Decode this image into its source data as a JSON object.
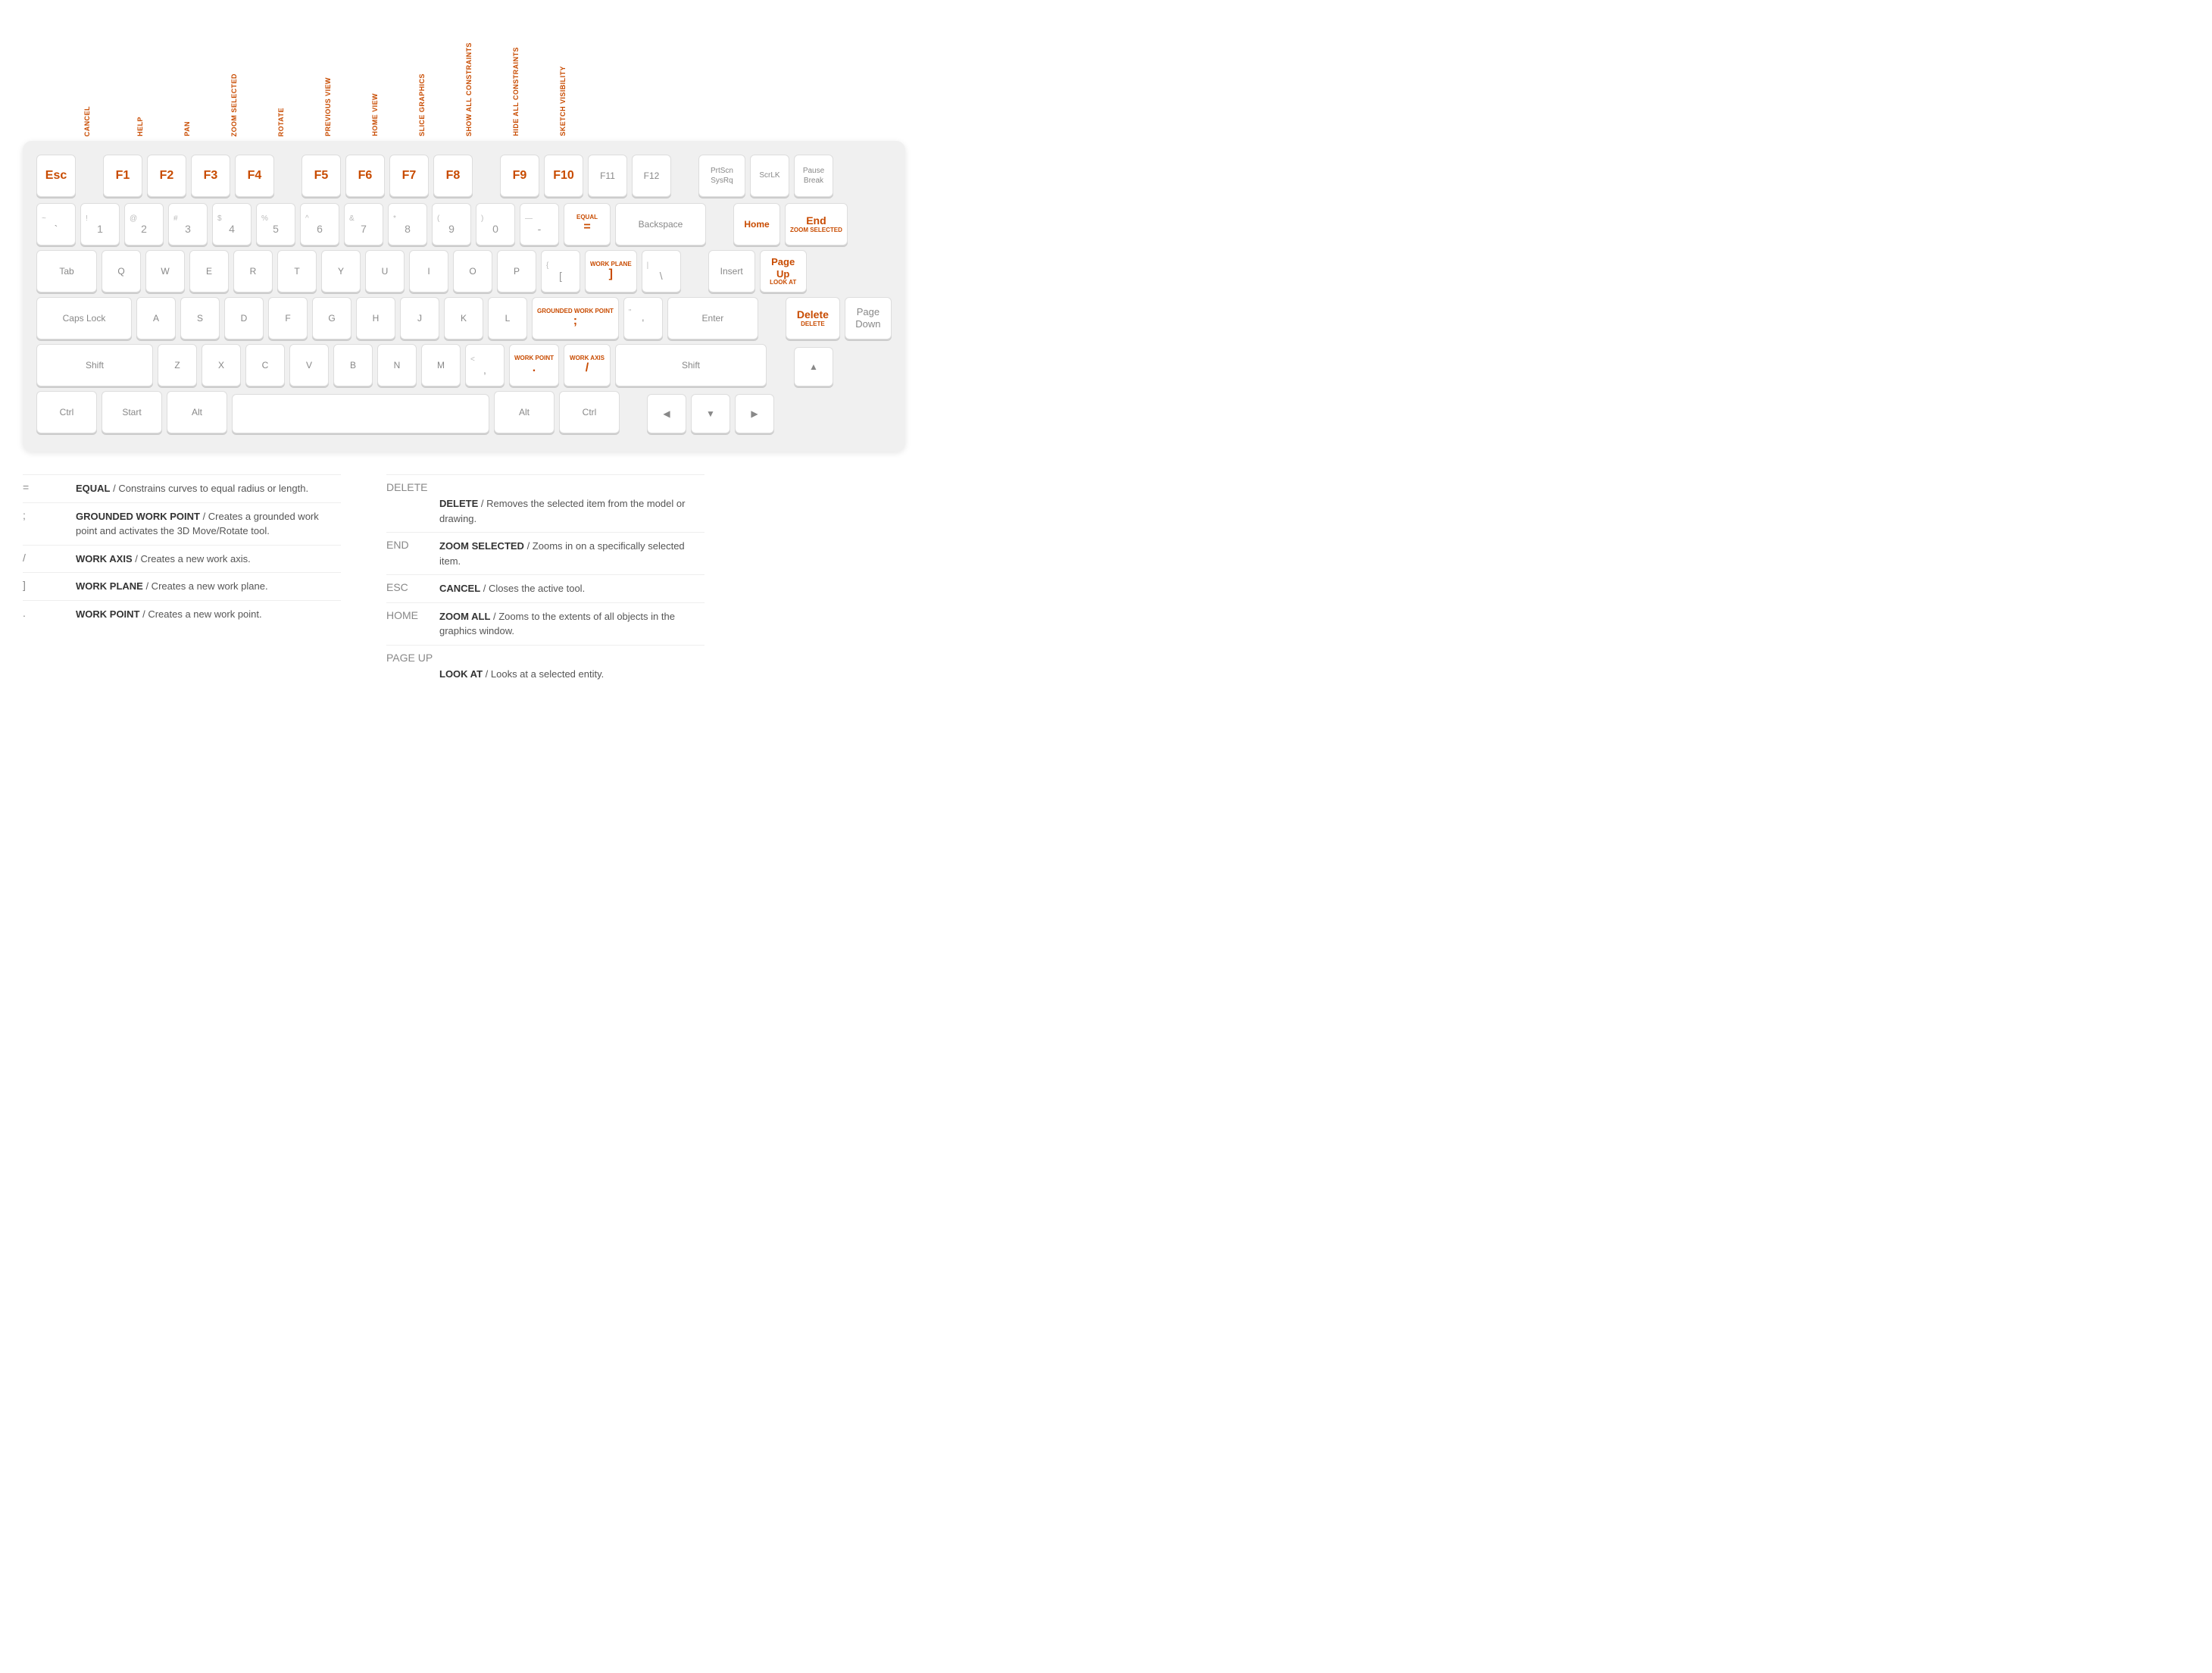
{
  "fkey_labels": [
    {
      "label": "CANCEL",
      "key": "Esc"
    },
    {
      "label": "HELP",
      "key": "F1"
    },
    {
      "label": "PAN",
      "key": "F2"
    },
    {
      "label": "ZOOM SELECTED",
      "key": "F3"
    },
    {
      "label": "ROTATE",
      "key": "F4"
    },
    {
      "label": "PREVIOUS VIEW",
      "key": "F5"
    },
    {
      "label": "HOME VIEW",
      "key": "F6"
    },
    {
      "label": "SLICE GRAPHICS",
      "key": "F7"
    },
    {
      "label": "SHOW ALL CONSTRAINTS",
      "key": "F8"
    },
    {
      "label": "HIDE ALL CONSTRAINTS",
      "key": "F9"
    },
    {
      "label": "SKETCH VISIBILITY",
      "key": "F10"
    },
    {
      "label": "",
      "key": "F11"
    },
    {
      "label": "",
      "key": "F12"
    }
  ],
  "rows": {
    "function_row": [
      {
        "id": "esc",
        "label": "Esc",
        "orange": true,
        "width": "normal"
      },
      {
        "id": "f1",
        "label": "F1",
        "orange": true,
        "width": "normal"
      },
      {
        "id": "f2",
        "label": "F2",
        "orange": true,
        "width": "normal"
      },
      {
        "id": "f3",
        "label": "F3",
        "orange": true,
        "width": "normal"
      },
      {
        "id": "f4",
        "label": "F4",
        "orange": true,
        "width": "normal"
      },
      {
        "id": "f5",
        "label": "F5",
        "orange": true,
        "width": "normal"
      },
      {
        "id": "f6",
        "label": "F6",
        "orange": true,
        "width": "normal"
      },
      {
        "id": "f7",
        "label": "F7",
        "orange": true,
        "width": "normal"
      },
      {
        "id": "f8",
        "label": "F8",
        "orange": true,
        "width": "normal"
      },
      {
        "id": "f9",
        "label": "F9",
        "orange": true,
        "width": "normal"
      },
      {
        "id": "f10",
        "label": "F10",
        "orange": true,
        "width": "normal"
      },
      {
        "id": "f11",
        "label": "F11",
        "orange": false,
        "width": "normal"
      },
      {
        "id": "f12",
        "label": "F12",
        "orange": false,
        "width": "normal"
      }
    ]
  },
  "legend": [
    {
      "key": "=",
      "title": "EQUAL",
      "desc": "Constrains curves to equal radius or length."
    },
    {
      "key": "DELETE",
      "title": "",
      "desc": ""
    },
    {
      "key": ";",
      "title": "GROUNDED WORK POINT",
      "desc": "Creates a grounded work point and activates the 3D Move/Rotate tool."
    },
    {
      "key": "DELETE",
      "title": "DELETE",
      "desc": "Removes the selected item from the model or drawing."
    },
    {
      "key": "/",
      "title": "WORK AXIS",
      "desc": "Creates a new work axis."
    },
    {
      "key": "END",
      "title": "ZOOM SELECTED",
      "desc": "Zooms in on a specifically selected item."
    },
    {
      "key": "]",
      "title": "WORK PLANE",
      "desc": "Creates a new work plane."
    },
    {
      "key": "ESC",
      "title": "CANCEL",
      "desc": "Closes the active tool."
    },
    {
      "key": ".",
      "title": "WORK POINT",
      "desc": "Creates a new work point."
    },
    {
      "key": "HOME",
      "title": "ZOOM ALL",
      "desc": "Zooms to the extents of all objects in the graphics window."
    },
    {
      "key": "",
      "title": "",
      "desc": ""
    },
    {
      "key": "PAGE UP",
      "title": "LOOK AT",
      "desc": "Looks at a selected entity."
    }
  ]
}
